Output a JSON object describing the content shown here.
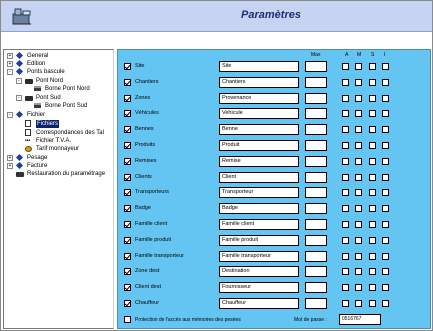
{
  "window": {
    "title": "Paramètres"
  },
  "tree": {
    "items": [
      {
        "label": "General",
        "icon": "diamond-icon",
        "expander": "+"
      },
      {
        "label": "Edition",
        "icon": "diamond-icon",
        "expander": "+"
      },
      {
        "label": "Ponts bascule",
        "icon": "diamond-icon",
        "expander": "-"
      },
      {
        "label": "Pont Nord",
        "icon": "truck-icon",
        "expander": "-"
      },
      {
        "label": "Borne Pont Nord",
        "icon": "terminal-icon"
      },
      {
        "label": "Pont Sud",
        "icon": "truck-icon",
        "expander": "-"
      },
      {
        "label": "Borne Pont Sud",
        "icon": "terminal-icon"
      },
      {
        "label": "Fichier",
        "icon": "diamond-icon",
        "expander": "-"
      },
      {
        "label": "Fichiers",
        "icon": "file-icon",
        "selected": true
      },
      {
        "label": "Correspondances des Tal",
        "icon": "file-icon"
      },
      {
        "label": "Fichier T.V.A.",
        "icon": "percent-icon"
      },
      {
        "label": "Tarif monnayeur",
        "icon": "coins-icon"
      },
      {
        "label": "Pesage",
        "icon": "diamond-icon",
        "expander": "+"
      },
      {
        "label": "Facture",
        "icon": "diamond-icon",
        "expander": "+"
      },
      {
        "label": "Restauration du paramétrage",
        "icon": "restore-icon"
      }
    ]
  },
  "panel": {
    "headers": {
      "max": "Max",
      "a": "A",
      "m": "M",
      "s": "S",
      "i": "I"
    },
    "rows": [
      {
        "label": "Site",
        "value": "Site",
        "checked": true
      },
      {
        "label": "Chantiers",
        "value": "Chantiers",
        "checked": true
      },
      {
        "label": "Zones",
        "value": "Provenance",
        "checked": true
      },
      {
        "label": "Véhicules",
        "value": "Vehicule",
        "checked": true
      },
      {
        "label": "Bennes",
        "value": "Benne",
        "checked": true
      },
      {
        "label": "Produits",
        "value": "Produit",
        "checked": true
      },
      {
        "label": "Remises",
        "value": "Remise",
        "checked": true
      },
      {
        "label": "Clients",
        "value": "Client",
        "checked": true
      },
      {
        "label": "Transporteurs",
        "value": "Transporteur",
        "checked": true
      },
      {
        "label": "Badge",
        "value": "Badge",
        "checked": true
      },
      {
        "label": "Famille client",
        "value": "Famille client",
        "checked": true
      },
      {
        "label": "Famille produit",
        "value": "Famille produit",
        "checked": true
      },
      {
        "label": "Famille transporteur",
        "value": "Famille transporteur",
        "checked": true
      },
      {
        "label": "Zone dest",
        "value": "Destination",
        "checked": true
      },
      {
        "label": "Client dest",
        "value": "Fournisseur",
        "checked": true
      },
      {
        "label": "Chauffeur",
        "value": "Chauffeur",
        "checked": true
      }
    ],
    "protection": {
      "label": "Protection de l'accès aux mémoires des pesées",
      "checked": false,
      "password_label": "Mot de passe :",
      "password_value": "0516767"
    }
  },
  "colors": {
    "header_bg": "#c6d4f2",
    "title": "#1a2f78",
    "panel_bg": "#64c5f2",
    "tree_selected": "#0a246a"
  }
}
